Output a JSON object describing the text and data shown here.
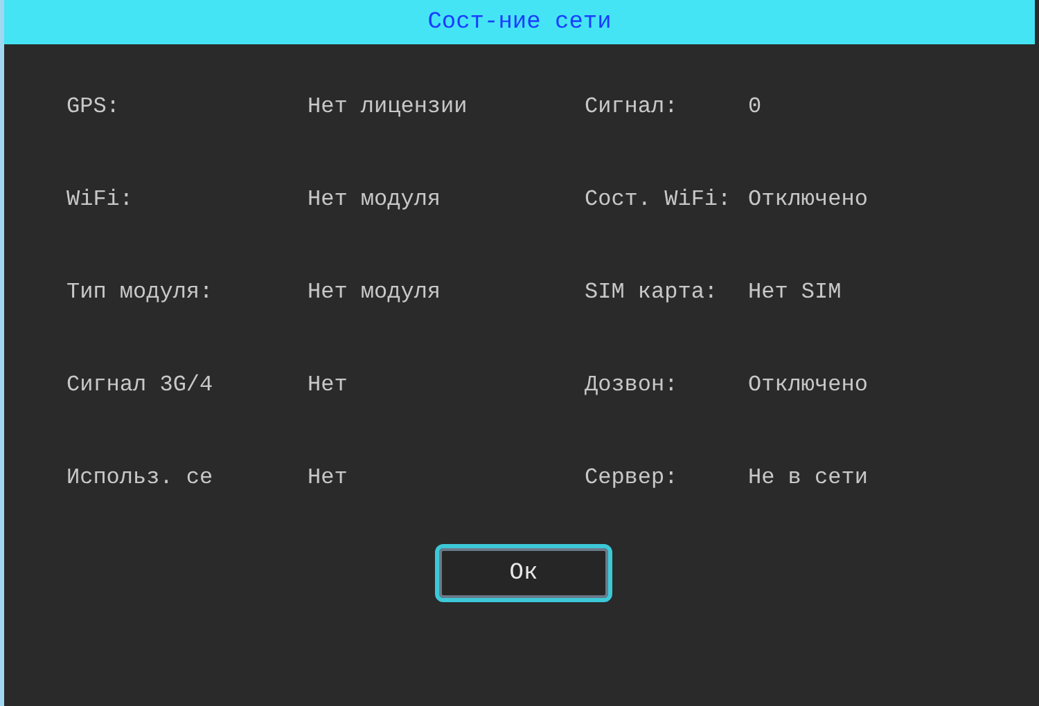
{
  "window": {
    "title": "Сост-ние сети"
  },
  "rows": [
    {
      "left": {
        "label": "GPS:",
        "value": "Нет лицензии"
      },
      "right": {
        "label": "Сигнал:",
        "value": "0"
      }
    },
    {
      "left": {
        "label": "WiFi:",
        "value": "Нет модуля"
      },
      "right": {
        "label": "Сост. WiFi:",
        "value": "Отключено"
      }
    },
    {
      "left": {
        "label": "Тип модуля:",
        "value": "Нет модуля"
      },
      "right": {
        "label": "SIM карта:",
        "value": "Нет SIM"
      }
    },
    {
      "left": {
        "label": "Сигнал 3G/4",
        "value": "Нет"
      },
      "right": {
        "label": "Дозвон:",
        "value": "Отключено"
      }
    },
    {
      "left": {
        "label": "Использ. се",
        "value": "Нет"
      },
      "right": {
        "label": "Сервер:",
        "value": "Не в сети"
      }
    }
  ],
  "buttons": [
    "Ок"
  ]
}
